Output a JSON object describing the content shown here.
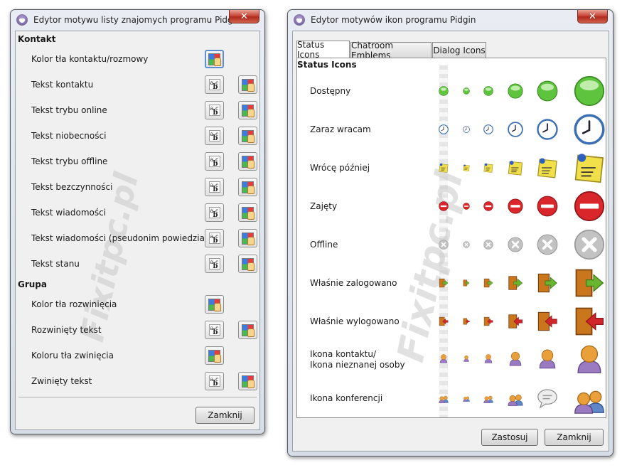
{
  "left_window": {
    "title": "Edytor motywu listy znajomych programu Pidgin",
    "close_label": "✕",
    "sections": [
      {
        "heading": "Kontakt",
        "rows": [
          {
            "label": "Kolor tła kontaktu/rozmowy"
          },
          {
            "label": "Tekst kontaktu"
          },
          {
            "label": "Tekst trybu online"
          },
          {
            "label": "Tekst niobecności"
          },
          {
            "label": "Tekst trybu offline"
          },
          {
            "label": "Tekst bezczynności"
          },
          {
            "label": "Tekst wiadomości"
          },
          {
            "label": "Tekst wiadomości (pseudonim powiedział)"
          },
          {
            "label": "Tekst stanu"
          }
        ]
      },
      {
        "heading": "Grupa",
        "rows": [
          {
            "label": "Kolor tła rozwinięcia"
          },
          {
            "label": "Rozwinięty tekst"
          },
          {
            "label": "Koloru tła zwinięcia"
          },
          {
            "label": "Zwinięty tekst"
          }
        ]
      }
    ],
    "close_button": "Zamknij"
  },
  "right_window": {
    "title": "Edytor motywów ikon programu Pidgin",
    "close_label": "✕",
    "tabs": [
      "Status Icons",
      "Chatroom Emblems",
      "Dialog Icons"
    ],
    "active_tab": "Status Icons",
    "panel_heading": "Status Icons",
    "rows": [
      {
        "label": "Dostępny",
        "icon": "available-icon"
      },
      {
        "label": "Zaraz wracam",
        "icon": "away-clock-icon"
      },
      {
        "label": "Wrócę później",
        "icon": "extended-away-note-icon"
      },
      {
        "label": "Zajęty",
        "icon": "busy-icon"
      },
      {
        "label": "Offline",
        "icon": "offline-icon"
      },
      {
        "label": "Właśnie zalogowano",
        "icon": "log-in-door-icon"
      },
      {
        "label": "Właśnie wylogowano",
        "icon": "log-out-door-icon"
      },
      {
        "label": "Ikona kontaktu/\nIkona nieznanej osoby",
        "label_line1": "Ikona kontaktu/",
        "label_line2": "Ikona nieznanej osoby",
        "icon": "person-icon"
      },
      {
        "label": "Ikona konferencji",
        "icon": "conference-icon"
      }
    ],
    "apply_button": "Zastosuj",
    "close_button": "Zamknij"
  },
  "watermark": "Fixitpc.pl",
  "colors": {
    "available": "#5fc43d",
    "away": "#3d6fb3",
    "note": "#f2e04b",
    "busy": "#d9262a",
    "offline": "#c2c2c2",
    "login_arrow": "#6ab52f",
    "logout_arrow": "#d0262a",
    "door": "#c9761d",
    "person": "#e9a03b",
    "person_body": "#9a7bc2"
  }
}
